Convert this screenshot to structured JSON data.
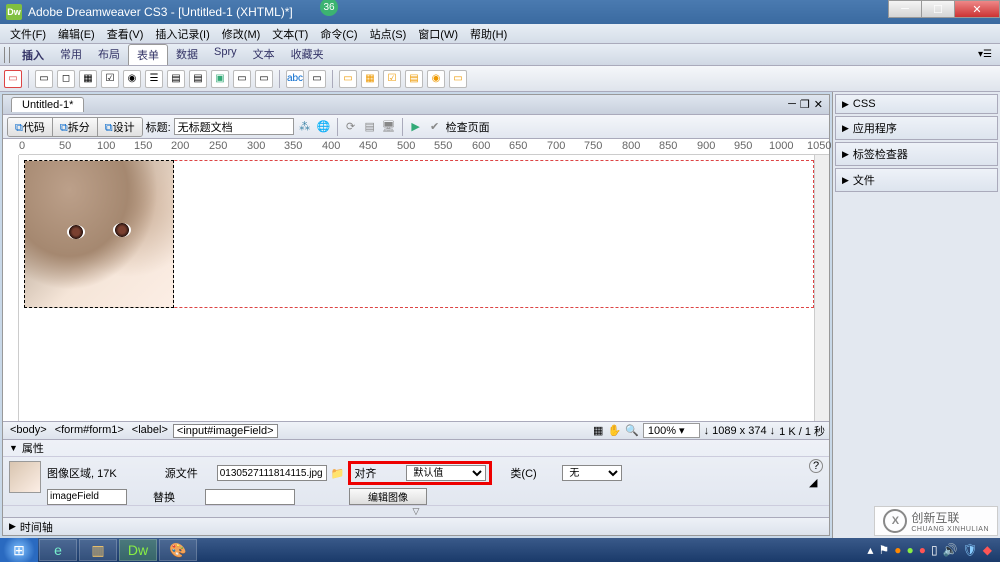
{
  "titlebar": {
    "app": "Adobe Dreamweaver CS3 - [Untitled-1 (XHTML)*]",
    "badge": "36",
    "icon": "Dw"
  },
  "menu": [
    "文件(F)",
    "编辑(E)",
    "查看(V)",
    "插入记录(I)",
    "修改(M)",
    "文本(T)",
    "命令(C)",
    "站点(S)",
    "窗口(W)",
    "帮助(H)"
  ],
  "insert": {
    "label": "插入",
    "tabs": [
      "常用",
      "布局",
      "表单",
      "数据",
      "Spry",
      "文本",
      "收藏夹"
    ],
    "active": 2
  },
  "panels": [
    "CSS",
    "应用程序",
    "标签检查器",
    "文件"
  ],
  "doc": {
    "tab": "Untitled-1*",
    "views": [
      "代码",
      "拆分",
      "设计"
    ],
    "title_label": "标题:",
    "title_value": "无标题文档",
    "check_label": "检查页面",
    "ruler": [
      "0",
      "50",
      "100",
      "150",
      "200",
      "250",
      "300",
      "350",
      "400",
      "450",
      "500",
      "550",
      "600",
      "650",
      "700",
      "750",
      "800",
      "850",
      "900",
      "950",
      "1000",
      "1050"
    ]
  },
  "tagbar": {
    "tags": [
      "<body>",
      "<form#form1>",
      "<label>",
      "<input#imageField>"
    ],
    "zoom": "100%",
    "dims": "1089 x 374",
    "size": "1 K / 1 秒"
  },
  "props": {
    "header": "属性",
    "area_label": "图像区域,",
    "area_size": "17K",
    "name_value": "imageField",
    "src_label": "源文件",
    "src_value": "0130527111814115.jpg",
    "alt_label": "替换",
    "alt_value": "",
    "align_label": "对齐",
    "align_value": "默认值",
    "class_label": "类(C)",
    "class_value": "无",
    "edit_btn": "编辑图像"
  },
  "timeline": "时间轴",
  "watermark": {
    "logo": "X",
    "text1": "创新互联",
    "text2": "CHUANG XINHULIAN"
  }
}
